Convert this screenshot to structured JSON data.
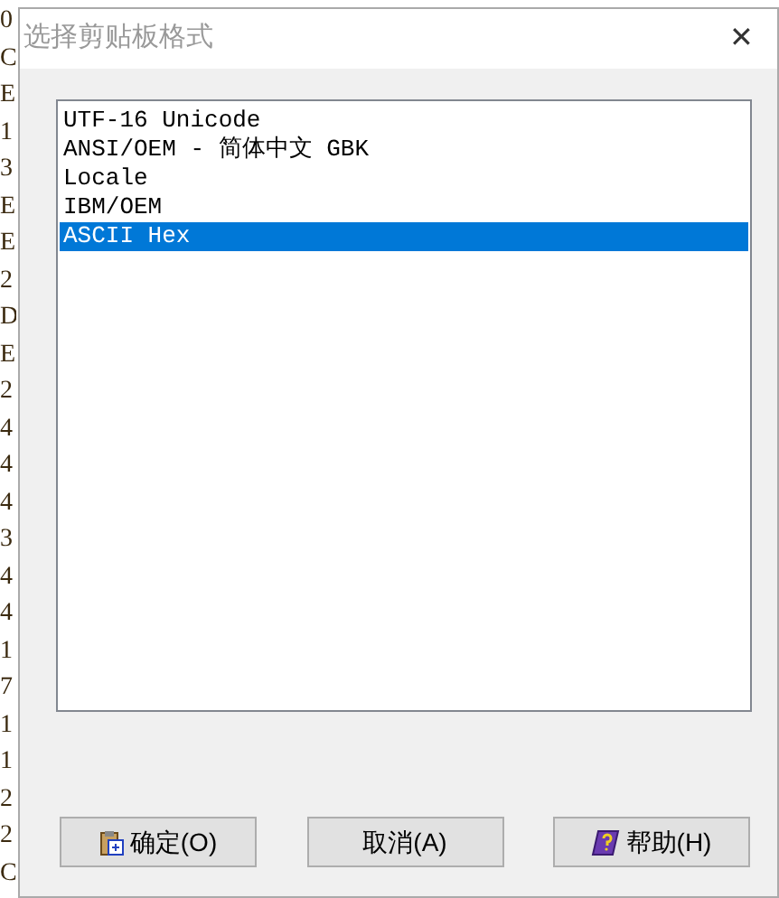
{
  "background_column": [
    "0",
    "C",
    "E",
    "1",
    "3",
    "E",
    "E",
    "2",
    "D",
    "E",
    "2",
    "4",
    "4",
    "4",
    "3",
    "4",
    "4",
    "1",
    "7",
    "1",
    "1",
    "2",
    "2",
    "C"
  ],
  "dialog": {
    "title": "选择剪贴板格式",
    "close": "✕",
    "formats": [
      {
        "label": "UTF-16 Unicode",
        "selected": false
      },
      {
        "label": "ANSI/OEM - 简体中文 GBK",
        "selected": false
      },
      {
        "label": "Locale",
        "selected": false
      },
      {
        "label": "IBM/OEM",
        "selected": false
      },
      {
        "label": "ASCII Hex",
        "selected": true
      }
    ],
    "buttons": [
      {
        "kind": "ok",
        "label": "确定(O)"
      },
      {
        "kind": "cancel",
        "label": "取消(A)"
      },
      {
        "kind": "help",
        "label": "帮助(H)"
      }
    ]
  }
}
